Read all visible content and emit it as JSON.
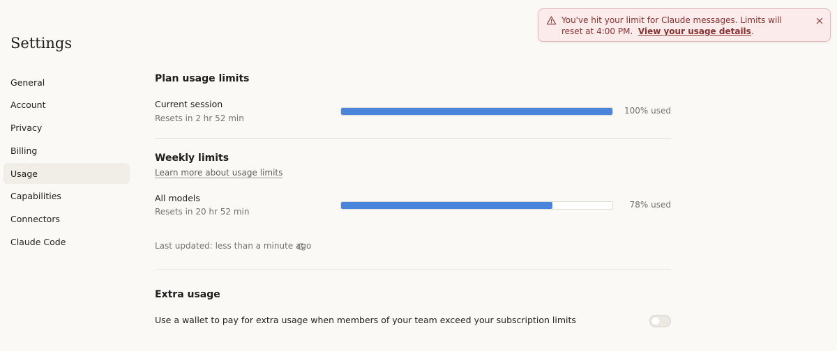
{
  "page": {
    "title": "Settings"
  },
  "sidebar": {
    "items": [
      {
        "label": "General"
      },
      {
        "label": "Account"
      },
      {
        "label": "Privacy"
      },
      {
        "label": "Billing"
      },
      {
        "label": "Usage",
        "active": true
      },
      {
        "label": "Capabilities"
      },
      {
        "label": "Connectors"
      },
      {
        "label": "Claude Code"
      }
    ]
  },
  "plan_usage": {
    "title": "Plan usage limits",
    "current_session": {
      "label": "Current session",
      "resets": "Resets in 2 hr 52 min",
      "percent": 100,
      "percent_label": "100% used"
    }
  },
  "weekly": {
    "title": "Weekly limits",
    "learn_more": "Learn more about usage limits",
    "all_models": {
      "label": "All models",
      "resets": "Resets in 20 hr 52 min",
      "percent": 78,
      "percent_label": "78% used"
    },
    "last_updated": "Last updated: less than a minute ago"
  },
  "extra_usage": {
    "title": "Extra usage",
    "description": "Use a wallet to pay for extra usage when members of your team exceed your subscription limits",
    "enabled": false
  },
  "alert": {
    "message": "You've hit your limit for Claude messages. Limits will reset at 4:00 PM.",
    "link_text": "View your usage details",
    "suffix": "."
  },
  "colors": {
    "progress": "#4a84db",
    "alert_bg": "#fbeceb",
    "alert_text": "#8a3030",
    "active_nav": "#f0eee6"
  },
  "icons": {
    "alert": "warning-triangle-icon",
    "close": "close-icon",
    "refresh": "refresh-icon"
  }
}
